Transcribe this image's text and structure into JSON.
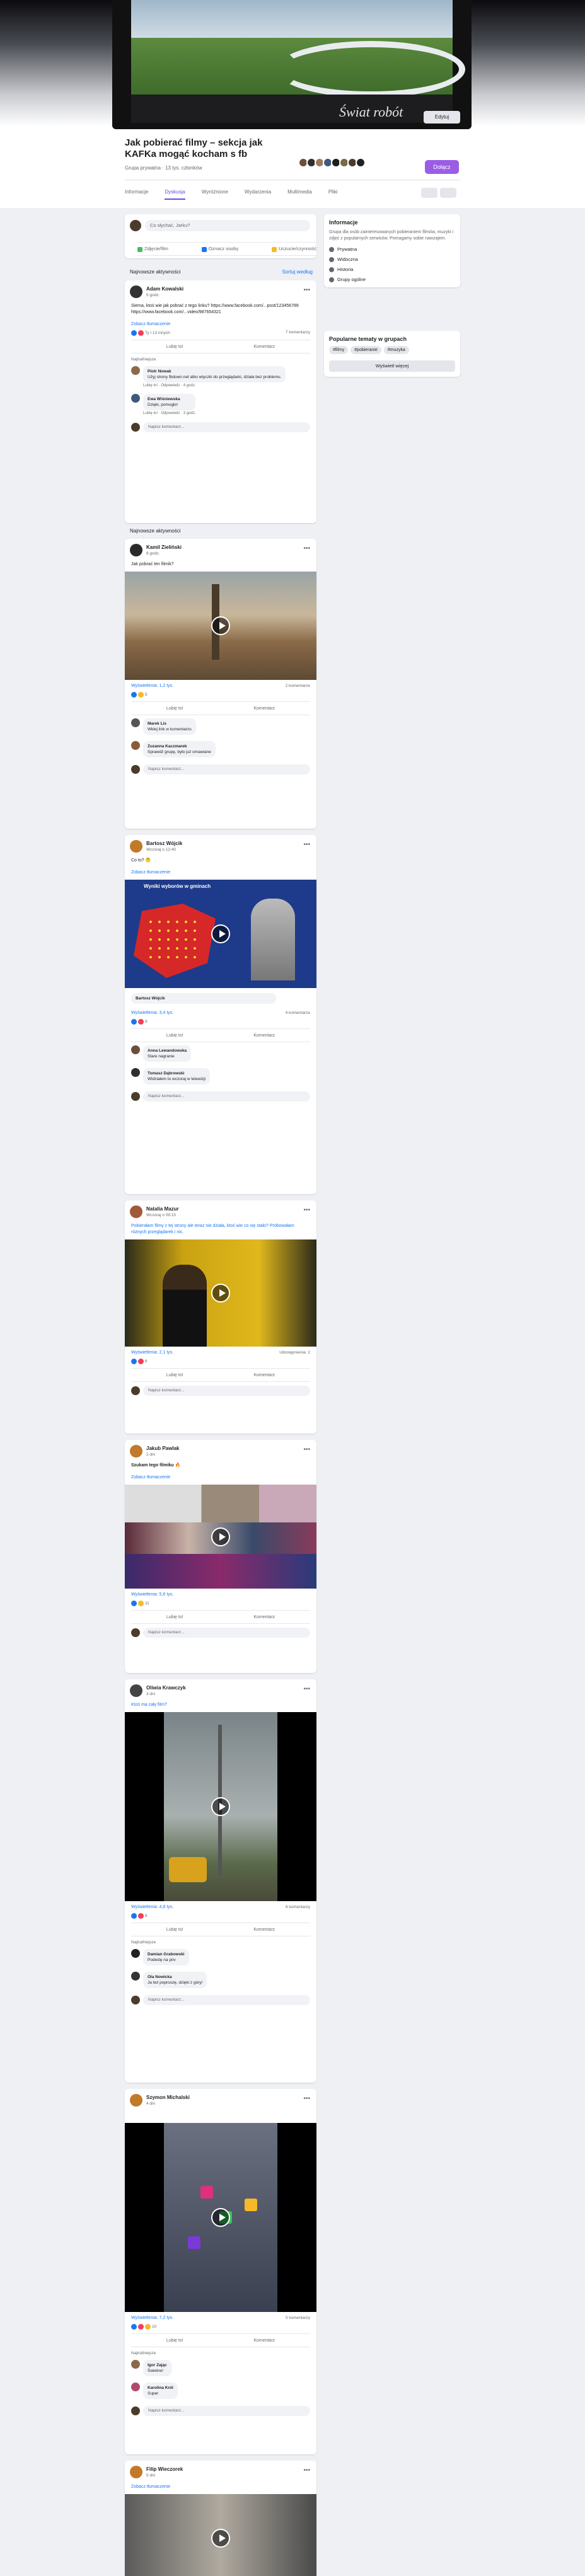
{
  "cover": {
    "title": "Świat robót",
    "edit_label": "Edytuj"
  },
  "page": {
    "name": "Jak pobierać filmy – sekcja jak KAFKa mogąć kocham s fb",
    "meta": "Grupa prywatna · 13 tys. członków",
    "join_label": "Dołącz"
  },
  "tabs": [
    "Informacje",
    "Dyskusja",
    "Wyróżnione",
    "Wydarzenia",
    "Multimedia",
    "Pliki"
  ],
  "composer": {
    "placeholder": "Co słychać, Jarku?",
    "actions": [
      "Zdjęcie/film",
      "Oznacz osoby",
      "Uczucie/czynność"
    ]
  },
  "feed_header": {
    "left": "Najnowsze aktywności",
    "right": "Sortuj według"
  },
  "sidebar": {
    "about_title": "Informacje",
    "about_text": "Grupa dla osób zainteresowanych pobieraniem filmów, muzyki i zdjęć z popularnych serwisów. Pomagamy sobie nawzajem.",
    "rows": [
      "Prywatna",
      "Widoczna",
      "Historia",
      "Grupy ogólne"
    ],
    "tags_title": "Popularne tematy w grupach",
    "tags": [
      "#filmy",
      "#pobieranie",
      "#muzyka"
    ],
    "more_label": "Wyświetl więcej"
  },
  "posts": [
    {
      "author": "Adam Kowalski",
      "time": "5 godz.",
      "text": "Siema, ktoś wie jak pobrać z tego linku? https://www.facebook.com/...post/123456789 https://www.facebook.com/...video/987654321",
      "link": "Zobacz tłumaczenie",
      "reactions": "Ty i 13 innych",
      "comments": "7 komentarzy",
      "c1_name": "Piotr Nowak",
      "c1_text": "Użyj strony fbdown.net albo wtyczki do przeglądarki, działa bez problemu.",
      "c1_meta": "Lubię to! · Odpowiedz · 4 godz.",
      "c2_name": "Ewa Wiśniewska",
      "c2_text": "Dzięki, pomogło!",
      "c2_meta": "Lubię to! · Odpowiedz · 3 godz."
    },
    {
      "author": "Kamil Zieliński",
      "time": "8 godz.",
      "text": "Jak pobrać ten filmik?",
      "reactions": "5",
      "comments": "2 komentarze",
      "views": "Wyświetlenia: 1,2 tys.",
      "c1_name": "Marek Lis",
      "c1_text": "Wklej link w komentarzu",
      "c2_name": "Zuzanna Kaczmarek",
      "c2_text": "Sprawdź grupę, było już omawiane"
    },
    {
      "author": "Bartosz Wójcik",
      "time": "Wczoraj o 12:40",
      "text": "Co to? 🤔",
      "link": "Zobacz tłumaczenie",
      "reactions": "9",
      "comments": "4 komentarze",
      "views": "Wyświetlenia: 3,4 tys.",
      "map_title": "Wyniki wyborów w gminach",
      "c1_name": "Anna Lewandowska",
      "c1_text": "Stare nagranie",
      "c2_name": "Tomasz Dąbrowski",
      "c2_text": "Widziałem to wczoraj w telewizji"
    },
    {
      "author": "Natalia Mazur",
      "time": "Wczoraj o 09:15",
      "text": "Pobierałam filmy z tej strony ale teraz nie działa, ktoś wie co się stało? Próbowałam różnych przeglądarek i nic.",
      "reactions": "6",
      "comments": "Udostępnienia: 2",
      "views": "Wyświetlenia: 2,1 tys."
    },
    {
      "author": "Jakub Pawlak",
      "time": "2 dni",
      "text": "Szukam tego filmiku 🔥",
      "link": "Zobacz tłumaczenie",
      "reactions": "11",
      "views": "Wyświetlenia: 5,6 tys."
    },
    {
      "author": "Oliwia Krawczyk",
      "time": "3 dni",
      "text": "Ktoś ma cały film?",
      "reactions": "8",
      "comments": "6 komentarzy",
      "views": "Wyświetlenia: 4,8 tys.",
      "c1_name": "Damian Grabowski",
      "c1_text": "Podeślę na priv",
      "c2_name": "Ola Nowicka",
      "c2_text": "Ja też poproszę, dzięki z góry!"
    },
    {
      "author": "Szymon Michalski",
      "time": "4 dni",
      "text": "",
      "reactions": "10",
      "comments": "5 komentarzy",
      "views": "Wyświetlenia: 7,2 tys.",
      "c1_name": "Igor Zając",
      "c1_text": "Świetne!",
      "c2_name": "Karolina Król",
      "c2_text": "Super"
    },
    {
      "author": "Filip Wieczorek",
      "time": "5 dni",
      "text": "",
      "link": "Zobacz tłumaczenie"
    }
  ],
  "ui": {
    "like": "Lubię to!",
    "comment": "Komentarz",
    "share": "Udostępnij",
    "write_comment": "Napisz komentarz...",
    "relevant": "Najtrafniejsze"
  },
  "colors": {
    "accent": "#9b5de5",
    "link": "#1877f2",
    "background": "#eef0f4"
  }
}
